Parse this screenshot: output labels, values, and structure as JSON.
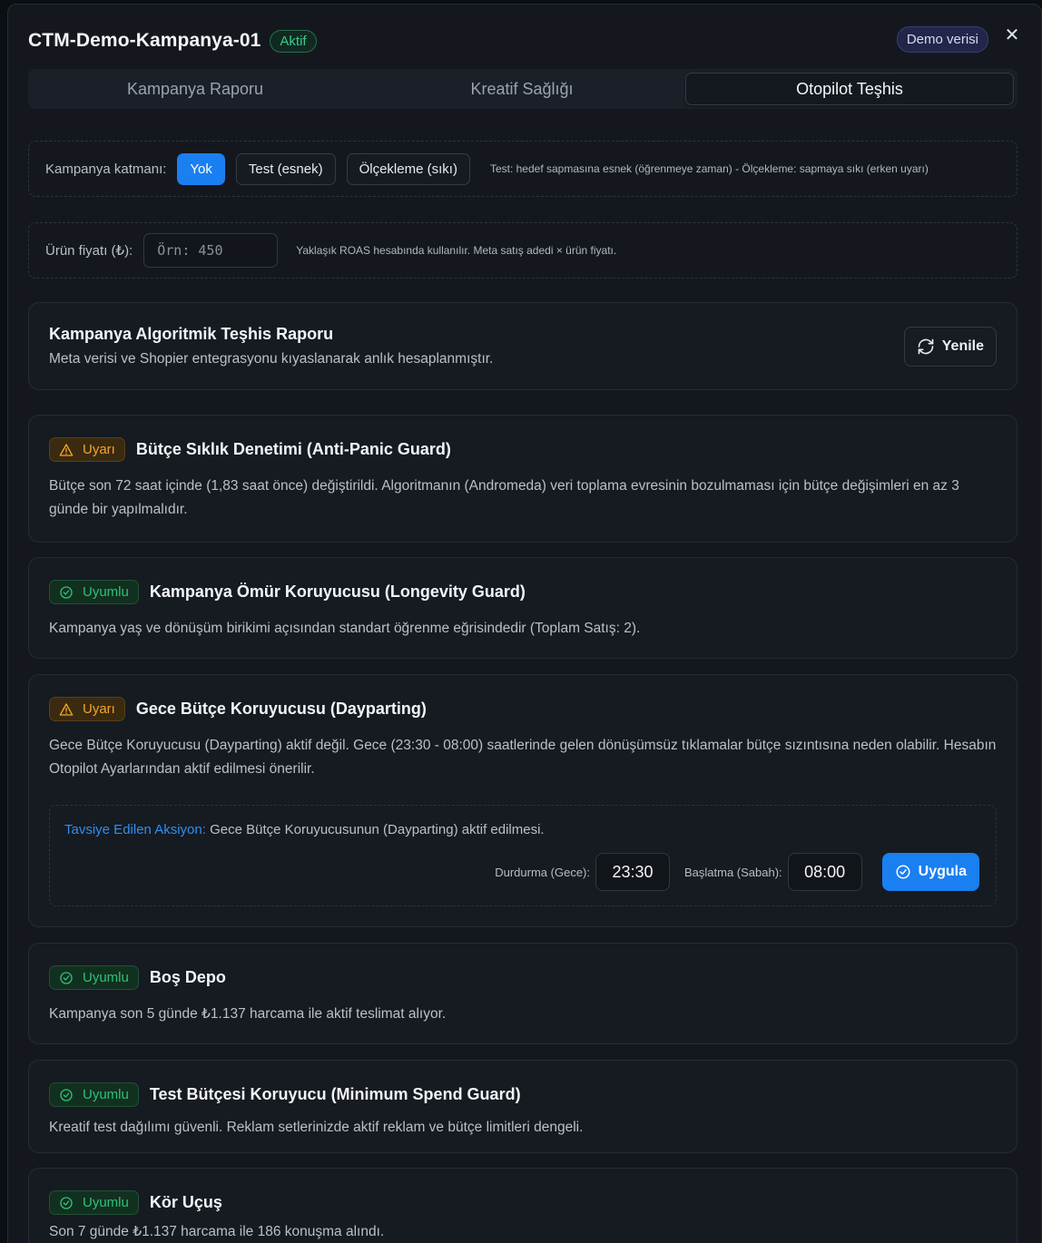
{
  "header": {
    "title": "CTM-Demo-Kampanya-01",
    "status": "Aktif",
    "demo_label": "Demo verisi",
    "close": "✕"
  },
  "tabs": [
    {
      "label": "Kampanya Raporu",
      "active": false
    },
    {
      "label": "Kreatif Sağlığı",
      "active": false
    },
    {
      "label": "Otopilot Teşhis",
      "active": true
    }
  ],
  "tier": {
    "label": "Kampanya katmanı:",
    "options": [
      "Yok",
      "Test (esnek)",
      "Ölçekleme (sıkı)"
    ],
    "selected": "Yok",
    "hint": "Test: hedef sapmasına esnek (öğrenmeye zaman) - Ölçekleme: sapmaya sıkı (erken uyarı)"
  },
  "price": {
    "label": "Ürün fiyatı (₺):",
    "placeholder": "Örn: 450",
    "value": "",
    "hint": "Yaklaşık ROAS hesabında kullanılır. Meta satış adedi × ürün fiyatı."
  },
  "report": {
    "title": "Kampanya Algoritmik Teşhis Raporu",
    "subtitle": "Meta verisi ve Shopier entegrasyonu kıyaslanarak anlık hesaplanmıştır.",
    "refresh_label": "Yenile"
  },
  "diagnostics": [
    {
      "status": "Uyarı",
      "title": "Bütçe Sıklık Denetimi (Anti-Panic Guard)",
      "body": "Bütçe son 72 saat içinde (1,83 saat önce) değiştirildi. Algoritmanın (Andromeda) veri toplama evresinin bozulmaması için bütçe değişimleri en az 3 günde bir yapılmalıdır."
    },
    {
      "status": "Uyumlu",
      "title": "Kampanya Ömür Koruyucusu (Longevity Guard)",
      "body": "Kampanya yaş ve dönüşüm birikimi açısından standart öğrenme eğrisindedir (Toplam Satış: 2)."
    },
    {
      "status": "Uyarı",
      "title": "Gece Bütçe Koruyucusu (Dayparting)",
      "body": "Gece Bütçe Koruyucusu (Dayparting) aktif değil. Gece (23:30 - 08:00) saatlerinde gelen dönüşümsüz tıklamalar bütçe sızıntısına neden olabilir. Hesabın Otopilot Ayarlarından aktif edilmesi önerilir."
    },
    {
      "status": "Uyumlu",
      "title": "Boş Depo",
      "body": "Kampanya son 5 günde ₺1.137 harcama ile aktif teslimat alıyor."
    },
    {
      "status": "Uyumlu",
      "title": "Test Bütçesi Koruyucu (Minimum Spend Guard)",
      "body": "Kreatif test dağılımı güvenli. Reklam setlerinizde aktif reklam ve bütçe limitleri dengeli."
    },
    {
      "status": "Uyumlu",
      "title": "Kör Uçuş",
      "body": "Son 7 günde ₺1.137 harcama ile 186 konuşma alındı."
    }
  ],
  "action": {
    "key": "Tavsiye Edilen Aksiyon:",
    "text": " Gece Bütçe Koruyucusunun (Dayparting) aktif edilmesi.",
    "stop_label": "Durdurma (Gece):",
    "stop_value": "23:30",
    "start_label": "Başlatma (Sabah):",
    "start_value": "08:00",
    "apply_label": "Uygula"
  },
  "colors": {
    "accent": "#1a7ff0",
    "warn": "#f1a52b",
    "ok": "#2fc07a",
    "bg": "#14181e"
  }
}
